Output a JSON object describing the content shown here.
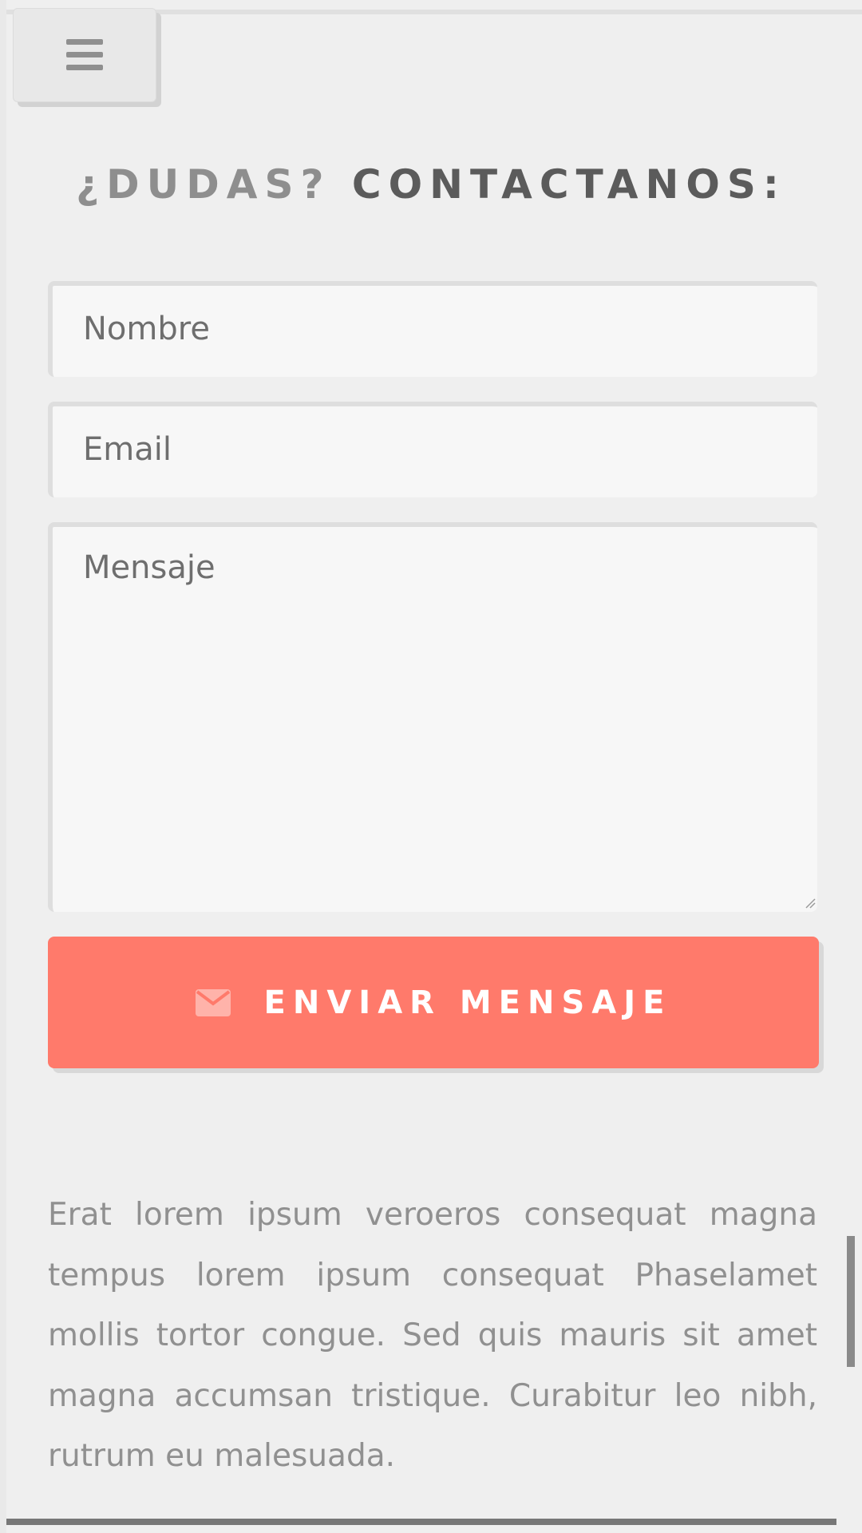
{
  "heading": {
    "part1": "¿DUDAS?",
    "part2": "CONTACTANOS:"
  },
  "form": {
    "name_placeholder": "Nombre",
    "email_placeholder": "Email",
    "message_placeholder": "Mensaje",
    "submit_label": "ENVIAR MENSAJE"
  },
  "body_text": "Erat lorem ipsum veroeros consequat magna tempus lorem ipsum consequat Phaselamet mollis tortor congue. Sed quis mauris sit amet magna accumsan tristique. Curabitur leo nibh, rutrum eu malesuada.",
  "icons": {
    "menu": "hamburger-menu-icon",
    "submit": "envelope-icon"
  },
  "colors": {
    "accent": "#ff7a6b",
    "background": "#efefef",
    "field_background": "#f7f7f7"
  }
}
